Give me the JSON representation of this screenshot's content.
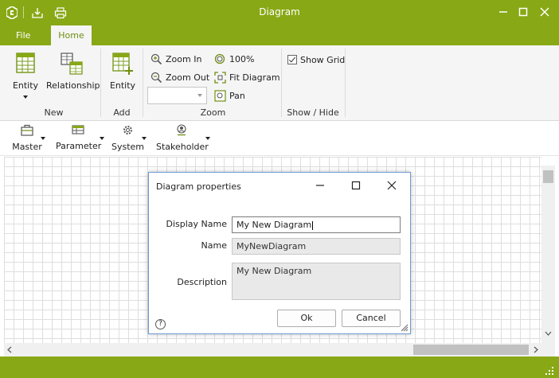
{
  "window": {
    "title": "Diagram"
  },
  "menu": {
    "file": "File",
    "home": "Home"
  },
  "ribbon": {
    "new_group": {
      "label": "New",
      "entity": "Entity",
      "relationship": "Relationship"
    },
    "add_group": {
      "label": "Add",
      "entity": "Entity"
    },
    "zoom_group": {
      "label": "Zoom",
      "zoom_in": "Zoom In",
      "zoom_out": "Zoom Out",
      "zoom_100": "100%",
      "fit_diagram": "Fit Diagram",
      "pan": "Pan",
      "zoom_value": ""
    },
    "show_hide_group": {
      "label": "Show / Hide",
      "show_grid": "Show Grid",
      "show_grid_checked": true
    }
  },
  "toolbar2": {
    "items": [
      "Master",
      "Parameter",
      "System",
      "Stakeholder"
    ]
  },
  "dialog": {
    "title": "Diagram properties",
    "display_name_label": "Display Name",
    "display_name_value": "My New Diagram",
    "name_label": "Name",
    "name_value": "MyNewDiagram",
    "description_label": "Description",
    "description_value": "My New Diagram",
    "ok": "Ok",
    "cancel": "Cancel",
    "help": "?"
  },
  "colors": {
    "accent": "#88a815",
    "ribbon_bg": "#f5f5f5",
    "dialog_border": "#6c9ad4"
  }
}
